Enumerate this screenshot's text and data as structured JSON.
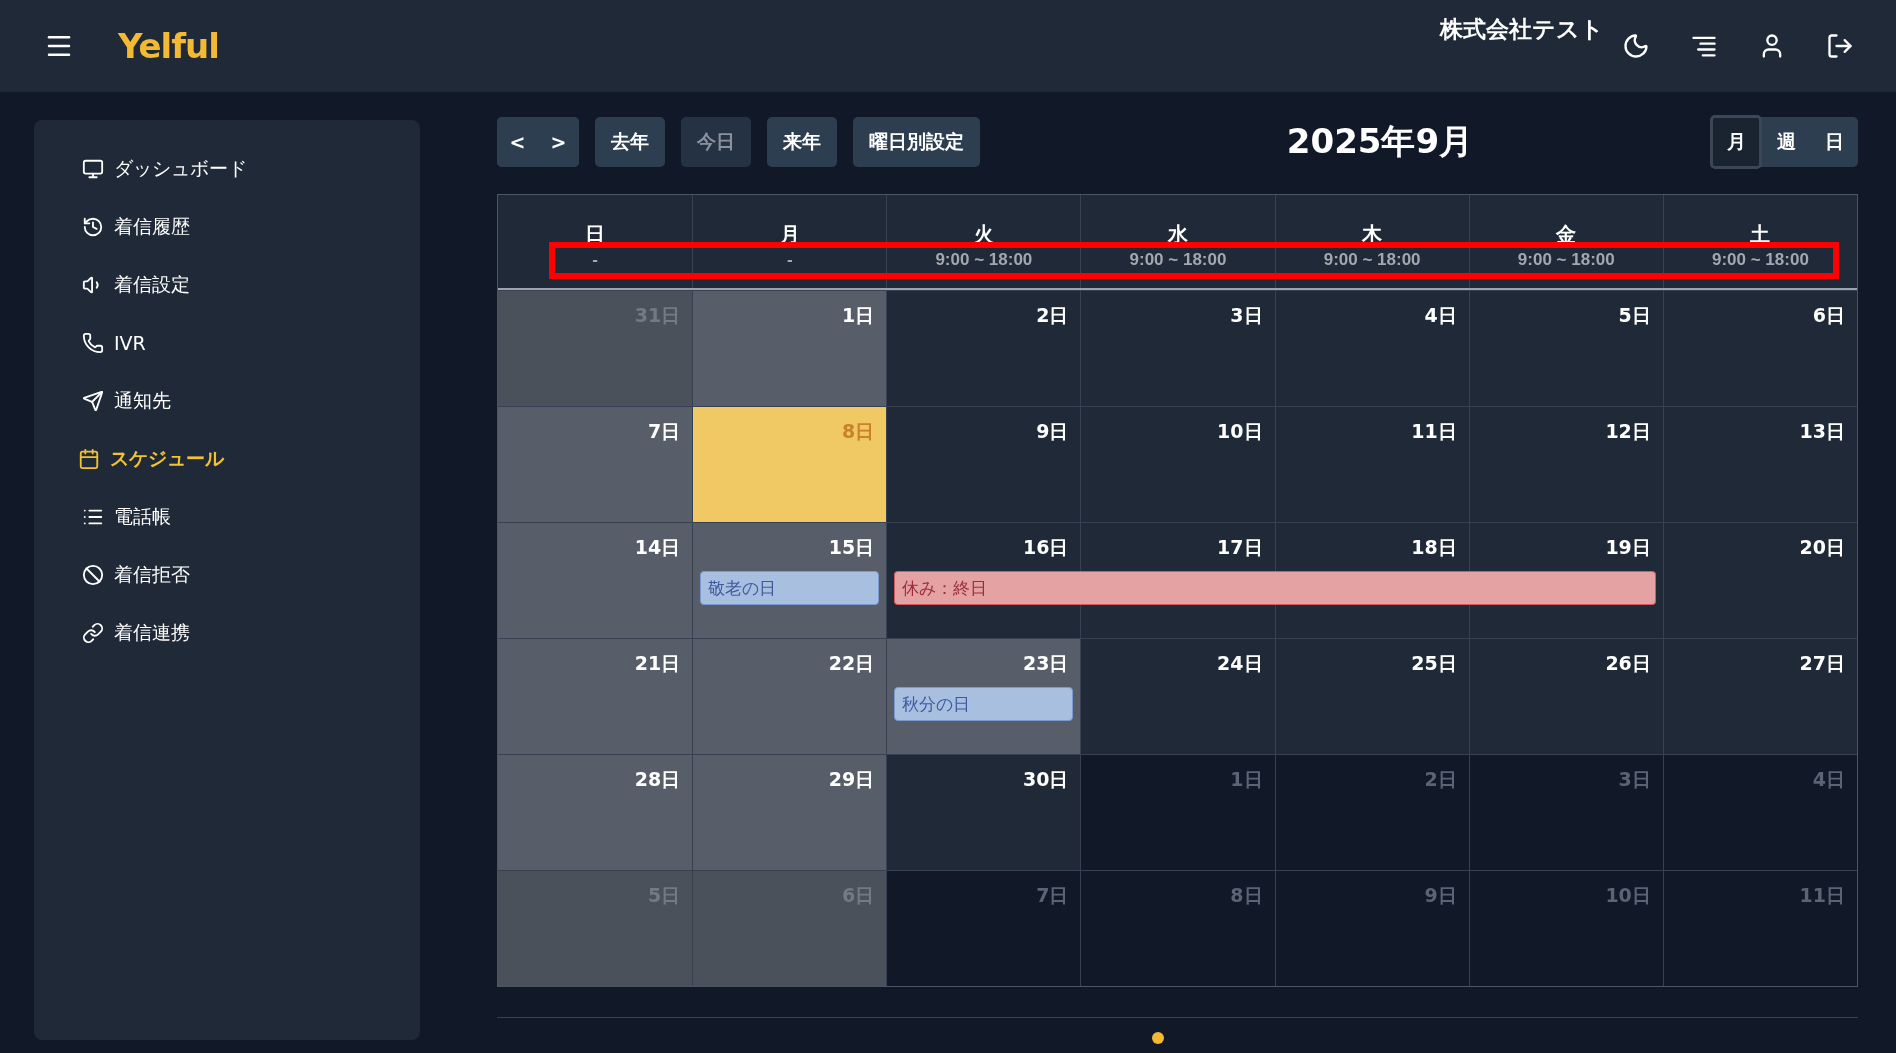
{
  "header": {
    "logo": "Yelful",
    "company": "株式会社テスト"
  },
  "sidebar": {
    "items": [
      {
        "label": "ダッシュボード",
        "selected": false
      },
      {
        "label": "着信履歴",
        "selected": false
      },
      {
        "label": "着信設定",
        "selected": false
      },
      {
        "label": "IVR",
        "selected": false
      },
      {
        "label": "通知先",
        "selected": false
      },
      {
        "label": "スケジュール",
        "selected": true
      },
      {
        "label": "電話帳",
        "selected": false
      },
      {
        "label": "着信拒否",
        "selected": false
      },
      {
        "label": "着信連携",
        "selected": false
      }
    ]
  },
  "toolbar": {
    "nav": [
      "<",
      ">"
    ],
    "buttons": [
      {
        "label": "去年",
        "disabled": false
      },
      {
        "label": "今日",
        "disabled": true
      },
      {
        "label": "来年",
        "disabled": false
      },
      {
        "label": "曜日別設定",
        "disabled": false
      }
    ],
    "title": "2025年9月",
    "views": [
      {
        "label": "月",
        "selected": true
      },
      {
        "label": "週",
        "selected": false
      },
      {
        "label": "日",
        "selected": false
      }
    ]
  },
  "calendar": {
    "hours_highlighted": true,
    "weekdays": [
      {
        "name": "日",
        "hours": "-"
      },
      {
        "name": "月",
        "hours": "-"
      },
      {
        "name": "火",
        "hours": "9:00 ~ 18:00"
      },
      {
        "name": "水",
        "hours": "9:00 ~ 18:00"
      },
      {
        "name": "木",
        "hours": "9:00 ~ 18:00"
      },
      {
        "name": "金",
        "hours": "9:00 ~ 18:00"
      },
      {
        "name": "土",
        "hours": "9:00 ~ 18:00"
      }
    ],
    "weeks": [
      {
        "days": [
          {
            "label": "31日",
            "outside": true,
            "closed": true,
            "today": false
          },
          {
            "label": "1日",
            "outside": false,
            "closed": true,
            "today": false
          },
          {
            "label": "2日",
            "outside": false,
            "closed": false,
            "today": false
          },
          {
            "label": "3日",
            "outside": false,
            "closed": false,
            "today": false
          },
          {
            "label": "4日",
            "outside": false,
            "closed": false,
            "today": false
          },
          {
            "label": "5日",
            "outside": false,
            "closed": false,
            "today": false
          },
          {
            "label": "6日",
            "outside": false,
            "closed": false,
            "today": false
          }
        ]
      },
      {
        "days": [
          {
            "label": "7日",
            "outside": false,
            "closed": true,
            "today": false
          },
          {
            "label": "8日",
            "outside": false,
            "closed": true,
            "today": true
          },
          {
            "label": "9日",
            "outside": false,
            "closed": false,
            "today": false
          },
          {
            "label": "10日",
            "outside": false,
            "closed": false,
            "today": false
          },
          {
            "label": "11日",
            "outside": false,
            "closed": false,
            "today": false
          },
          {
            "label": "12日",
            "outside": false,
            "closed": false,
            "today": false
          },
          {
            "label": "13日",
            "outside": false,
            "closed": false,
            "today": false
          }
        ]
      },
      {
        "days": [
          {
            "label": "14日",
            "outside": false,
            "closed": true,
            "today": false
          },
          {
            "label": "15日",
            "outside": false,
            "closed": true,
            "today": false,
            "event": {
              "label": "敬老の日",
              "kind": "holiday"
            }
          },
          {
            "label": "16日",
            "outside": false,
            "closed": false,
            "today": false,
            "event": {
              "label": "休み：終日",
              "kind": "closure"
            }
          },
          {
            "label": "17日",
            "outside": false,
            "closed": false,
            "today": false,
            "event_continues": true
          },
          {
            "label": "18日",
            "outside": false,
            "closed": false,
            "today": false,
            "event_continues": true
          },
          {
            "label": "19日",
            "outside": false,
            "closed": false,
            "today": false,
            "event_continues": true
          },
          {
            "label": "20日",
            "outside": false,
            "closed": false,
            "today": false
          }
        ]
      },
      {
        "days": [
          {
            "label": "21日",
            "outside": false,
            "closed": true,
            "today": false
          },
          {
            "label": "22日",
            "outside": false,
            "closed": true,
            "today": false
          },
          {
            "label": "23日",
            "outside": false,
            "closed": true,
            "today": false,
            "event": {
              "label": "秋分の日",
              "kind": "holiday"
            }
          },
          {
            "label": "24日",
            "outside": false,
            "closed": false,
            "today": false
          },
          {
            "label": "25日",
            "outside": false,
            "closed": false,
            "today": false
          },
          {
            "label": "26日",
            "outside": false,
            "closed": false,
            "today": false
          },
          {
            "label": "27日",
            "outside": false,
            "closed": false,
            "today": false
          }
        ]
      },
      {
        "days": [
          {
            "label": "28日",
            "outside": false,
            "closed": true,
            "today": false
          },
          {
            "label": "29日",
            "outside": false,
            "closed": true,
            "today": false
          },
          {
            "label": "30日",
            "outside": false,
            "closed": false,
            "today": false
          },
          {
            "label": "1日",
            "outside": true,
            "closed": false,
            "today": false
          },
          {
            "label": "2日",
            "outside": true,
            "closed": false,
            "today": false
          },
          {
            "label": "3日",
            "outside": true,
            "closed": false,
            "today": false
          },
          {
            "label": "4日",
            "outside": true,
            "closed": false,
            "today": false
          }
        ]
      },
      {
        "days": [
          {
            "label": "5日",
            "outside": true,
            "closed": true,
            "today": false
          },
          {
            "label": "6日",
            "outside": true,
            "closed": true,
            "today": false
          },
          {
            "label": "7日",
            "outside": true,
            "closed": false,
            "today": false
          },
          {
            "label": "8日",
            "outside": true,
            "closed": false,
            "today": false
          },
          {
            "label": "9日",
            "outside": true,
            "closed": false,
            "today": false
          },
          {
            "label": "10日",
            "outside": true,
            "closed": false,
            "today": false
          },
          {
            "label": "11日",
            "outside": true,
            "closed": false,
            "today": false
          }
        ]
      }
    ]
  }
}
